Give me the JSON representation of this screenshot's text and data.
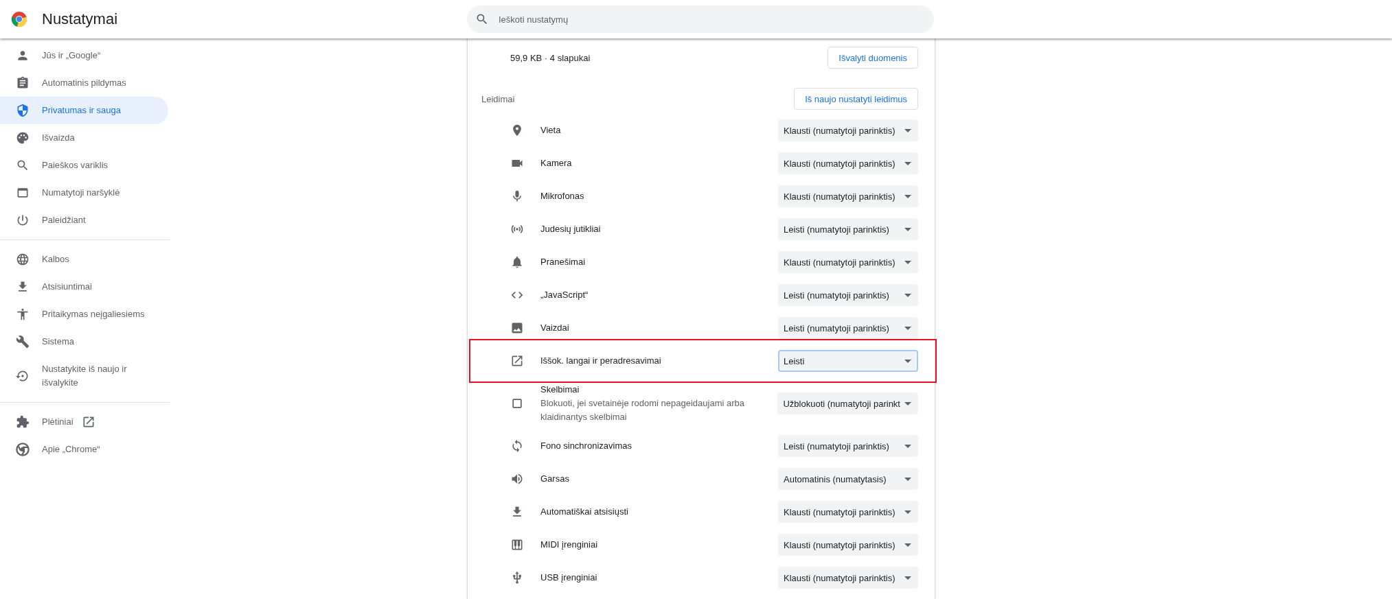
{
  "header": {
    "title": "Nustatymai",
    "search": {
      "placeholder": "Ieškoti nustatymų"
    }
  },
  "sidebar": {
    "sections": [
      {
        "items": [
          {
            "label": "Jūs ir „Google“",
            "selected": false,
            "external": false
          },
          {
            "label": "Automatinis pildymas",
            "selected": false,
            "external": false
          },
          {
            "label": "Privatumas ir sauga",
            "selected": true,
            "external": false
          },
          {
            "label": "Išvaizda",
            "selected": false,
            "external": false
          },
          {
            "label": "Paieškos variklis",
            "selected": false,
            "external": false
          },
          {
            "label": "Numatytoji naršyklė",
            "selected": false,
            "external": false
          },
          {
            "label": "Paleidžiant",
            "selected": false,
            "external": false
          }
        ]
      },
      {
        "items": [
          {
            "label": "Kalbos",
            "selected": false,
            "external": false
          },
          {
            "label": "Atsisiuntimai",
            "selected": false,
            "external": false
          },
          {
            "label": "Pritaikymas neįgaliesiems",
            "selected": false,
            "external": false
          },
          {
            "label": "Sistema",
            "selected": false,
            "external": false
          },
          {
            "label": "Nustatykite iš naujo ir išvalykite",
            "selected": false,
            "external": false
          }
        ]
      },
      {
        "items": [
          {
            "label": "Plėtiniai",
            "selected": false,
            "external": true
          },
          {
            "label": "Apie „Chrome“",
            "selected": false,
            "external": false
          }
        ]
      }
    ]
  },
  "site_data": {
    "usage": "59,9 KB · 4 slapukai",
    "button": "Išvalyti duomenis"
  },
  "permissions": {
    "title": "Leidimai",
    "reset_button": "Iš naujo nustatyti leidimus",
    "items": [
      {
        "label": "Vieta",
        "value": "Klausti (numatytoji parinktis)",
        "highlighted": false,
        "focused": false
      },
      {
        "label": "Kamera",
        "value": "Klausti (numatytoji parinktis)",
        "highlighted": false,
        "focused": false
      },
      {
        "label": "Mikrofonas",
        "value": "Klausti (numatytoji parinktis)",
        "highlighted": false,
        "focused": false
      },
      {
        "label": "Judesių jutikliai",
        "value": "Leisti (numatytoji parinktis)",
        "highlighted": false,
        "focused": false
      },
      {
        "label": "Pranešimai",
        "value": "Klausti (numatytoji parinktis)",
        "highlighted": false,
        "focused": false
      },
      {
        "label": "„JavaScript“",
        "value": "Leisti (numatytoji parinktis)",
        "highlighted": false,
        "focused": false
      },
      {
        "label": "Vaizdai",
        "value": "Leisti (numatytoji parinktis)",
        "highlighted": false,
        "focused": false
      },
      {
        "label": "Iššok. langai ir peradresavimai",
        "value": "Leisti",
        "highlighted": true,
        "focused": true
      },
      {
        "label": "Skelbimai",
        "description": "Blokuoti, jei svetainėje rodomi nepageidaujami arba klaidinantys skelbimai",
        "value": "Užblokuoti (numatytoji parinkt",
        "highlighted": false,
        "focused": false
      },
      {
        "label": "Fono sinchronizavimas",
        "value": "Leisti (numatytoji parinktis)",
        "highlighted": false,
        "focused": false
      },
      {
        "label": "Garsas",
        "value": "Automatinis (numatytasis)",
        "highlighted": false,
        "focused": false
      },
      {
        "label": "Automatiškai atsisiųsti",
        "value": "Klausti (numatytoji parinktis)",
        "highlighted": false,
        "focused": false
      },
      {
        "label": "MIDI įrenginiai",
        "value": "Klausti (numatytoji parinktis)",
        "highlighted": false,
        "focused": false
      },
      {
        "label": "USB įrenginiai",
        "value": "Klausti (numatytoji parinktis)",
        "highlighted": false,
        "focused": false
      }
    ]
  }
}
